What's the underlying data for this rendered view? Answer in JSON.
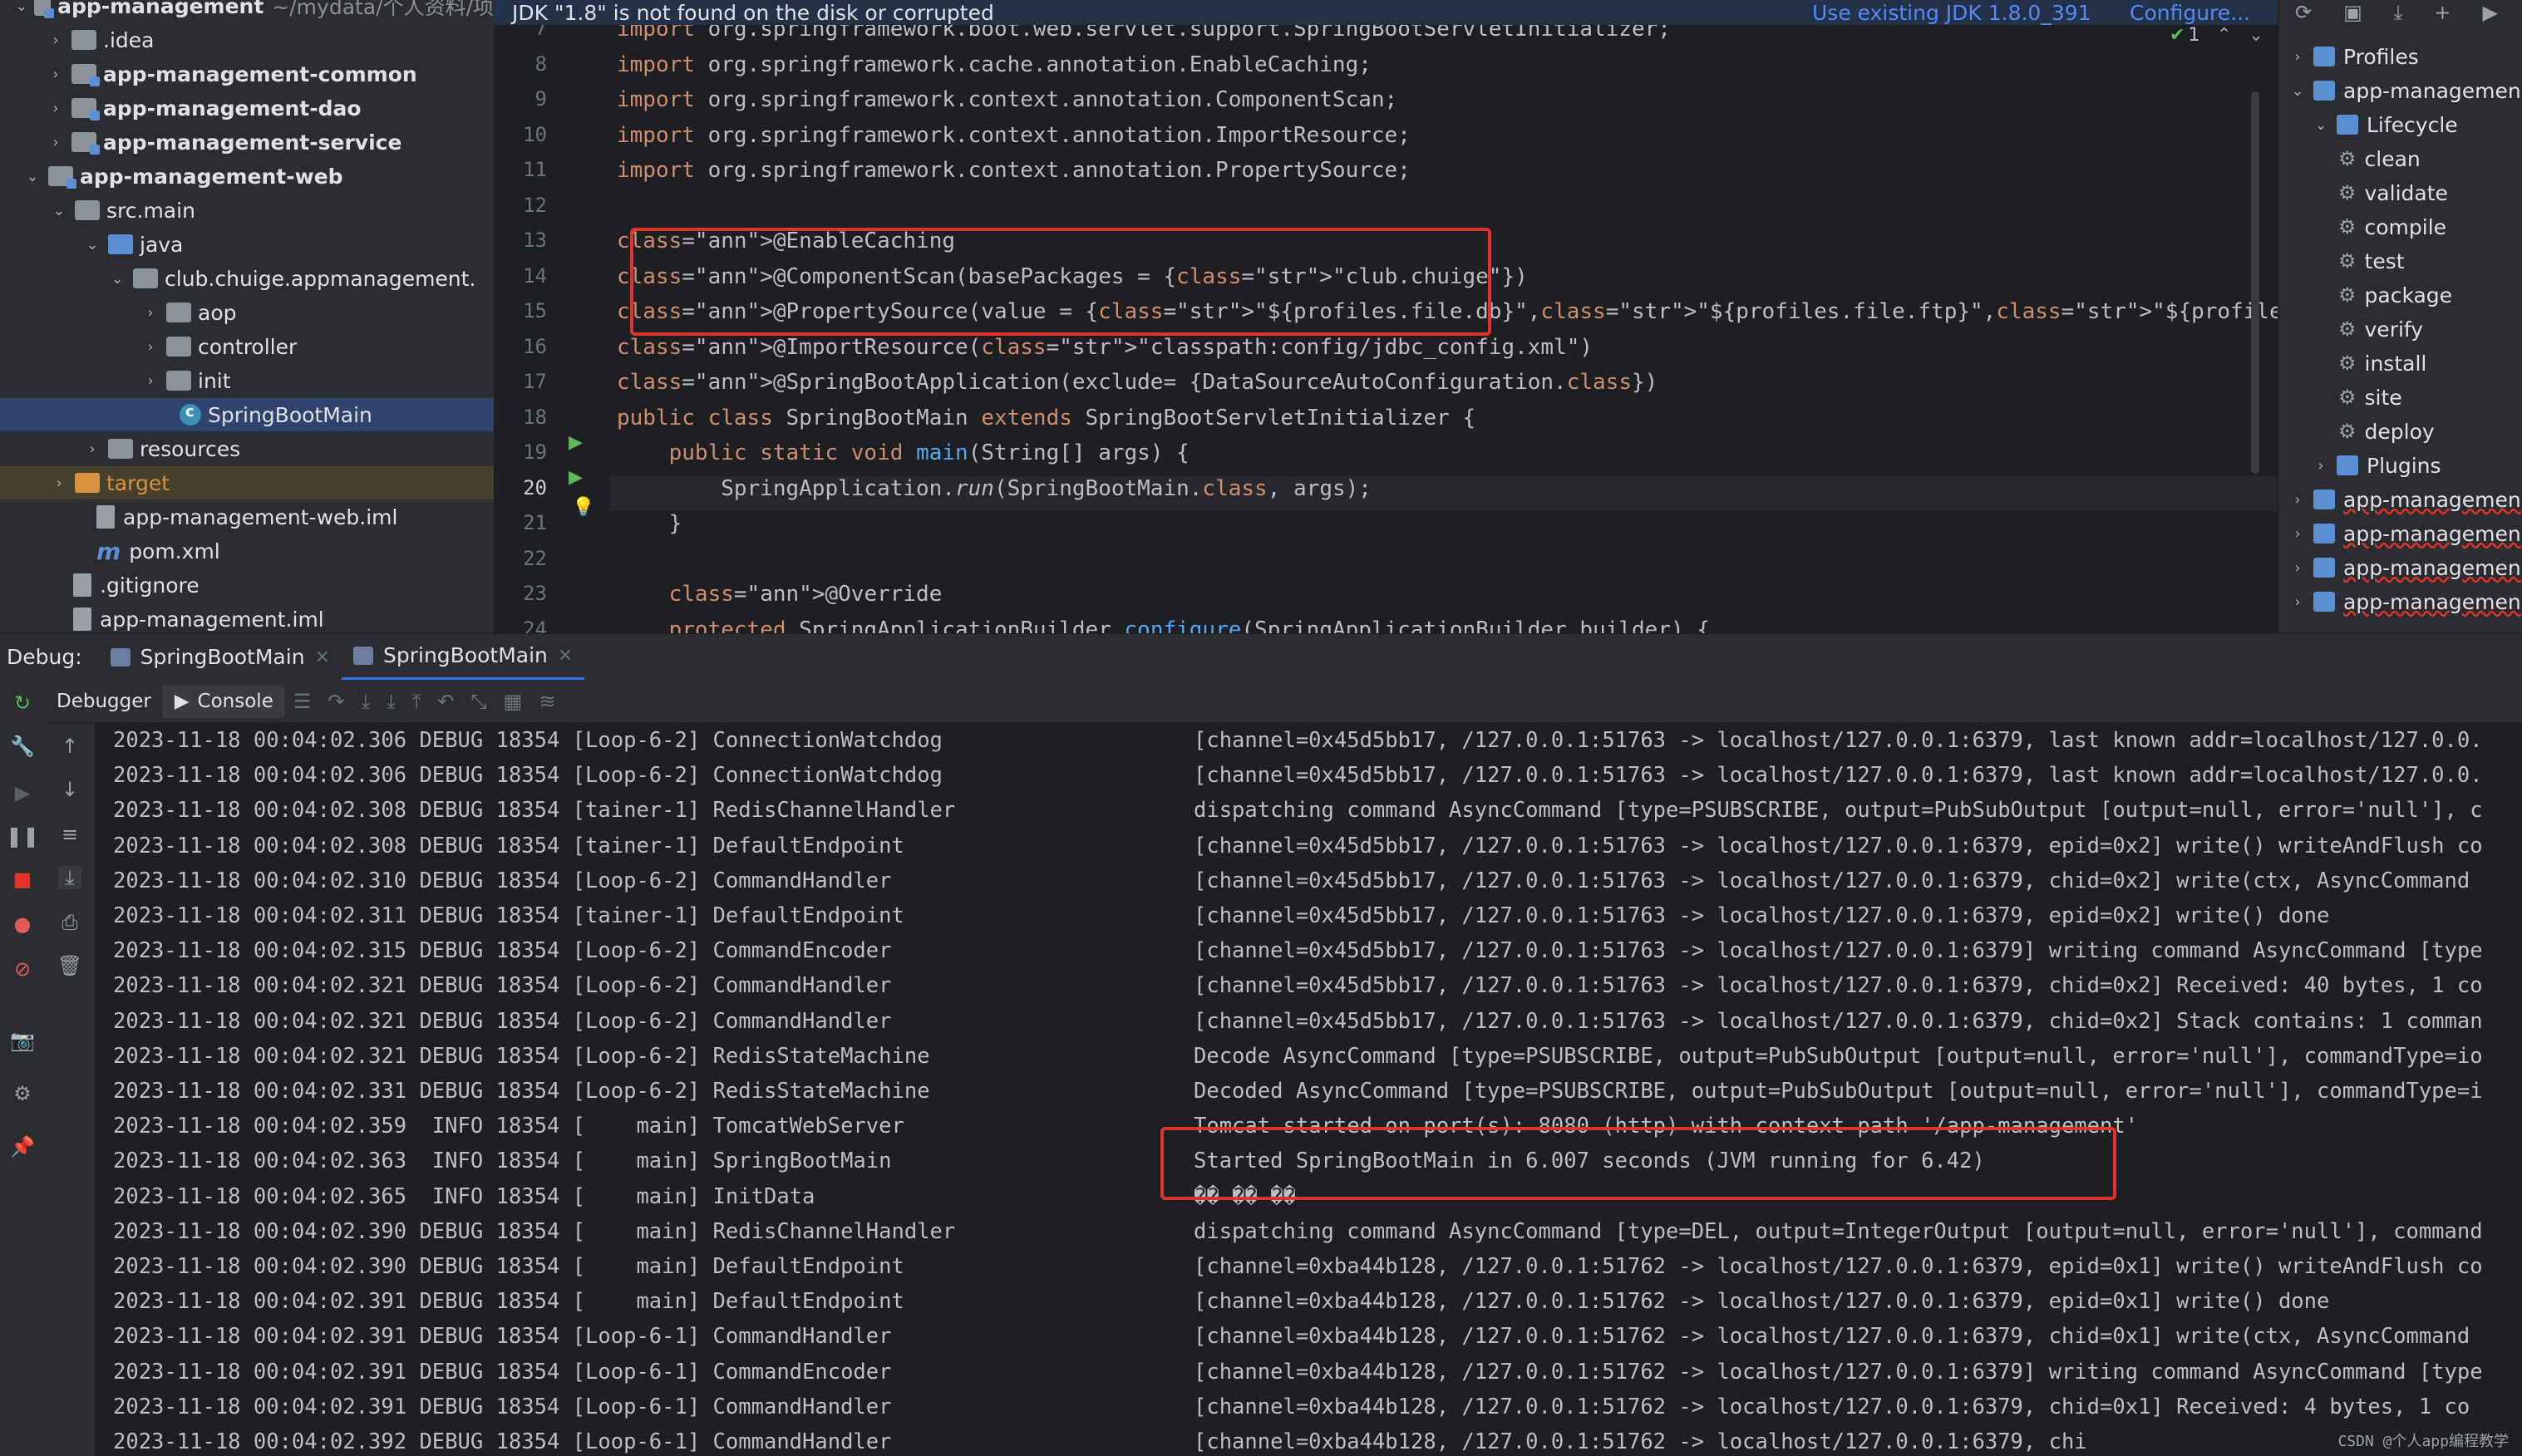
{
  "project_tree": {
    "items": [
      {
        "label": "app-management",
        "suffix": "~/mydata/个人资料/项",
        "kind": "module",
        "bold": true,
        "chevron": "down"
      },
      {
        "label": ".idea",
        "kind": "folder",
        "chevron": "right"
      },
      {
        "label": "app-management-common",
        "kind": "module",
        "bold": true,
        "chevron": "right"
      },
      {
        "label": "app-management-dao",
        "kind": "module",
        "bold": true,
        "chevron": "right"
      },
      {
        "label": "app-management-service",
        "kind": "module",
        "bold": true,
        "chevron": "right"
      },
      {
        "label": "app-management-web",
        "kind": "module",
        "bold": true,
        "chevron": "down"
      },
      {
        "label": "src.main",
        "kind": "folder",
        "chevron": "down"
      },
      {
        "label": "java",
        "kind": "folder-blue",
        "chevron": "down"
      },
      {
        "label": "club.chuige.appmanagement.",
        "kind": "package",
        "chevron": "down"
      },
      {
        "label": "aop",
        "kind": "package",
        "chevron": "right"
      },
      {
        "label": "controller",
        "kind": "package",
        "chevron": "right"
      },
      {
        "label": "init",
        "kind": "package",
        "chevron": "right"
      },
      {
        "label": "SpringBootMain",
        "kind": "class",
        "selected": true
      },
      {
        "label": "resources",
        "kind": "folder",
        "chevron": "right"
      },
      {
        "label": "target",
        "kind": "folder-orange",
        "chevron": "right"
      },
      {
        "label": "app-management-web.iml",
        "kind": "file"
      },
      {
        "label": "pom.xml",
        "kind": "maven-file"
      },
      {
        "label": ".gitignore",
        "kind": "file"
      },
      {
        "label": "app-management.iml",
        "kind": "file"
      }
    ]
  },
  "banner": {
    "message": "JDK \"1.8\" is not found on the disk or corrupted",
    "use_existing": "Use existing JDK 1.8.0_391",
    "configure": "Configure..."
  },
  "editor": {
    "inspection_count": "1",
    "lines": [
      {
        "num": "7",
        "text": "import org.springframework.boot.web.servlet.support.SpringBootServletInitializer;"
      },
      {
        "num": "8",
        "text": "import org.springframework.cache.annotation.EnableCaching;"
      },
      {
        "num": "9",
        "text": "import org.springframework.context.annotation.ComponentScan;"
      },
      {
        "num": "10",
        "text": "import org.springframework.context.annotation.ImportResource;"
      },
      {
        "num": "11",
        "text": "import org.springframework.context.annotation.PropertySource;"
      },
      {
        "num": "12",
        "text": ""
      },
      {
        "num": "13",
        "text": "@EnableCaching"
      },
      {
        "num": "14",
        "text": "@ComponentScan(basePackages = {\"club.chuige\"})"
      },
      {
        "num": "15",
        "text": "@PropertySource(value = {\"${profiles.file.db}\",\"${profiles.file.ftp}\",\"${profiles.file.redis}\",\"classpath:properties/common.p"
      },
      {
        "num": "16",
        "text": "@ImportResource(\"classpath:config/jdbc_config.xml\")"
      },
      {
        "num": "17",
        "text": "@SpringBootApplication(exclude= {DataSourceAutoConfiguration.class})"
      },
      {
        "num": "18",
        "text": "public class SpringBootMain extends SpringBootServletInitializer {"
      },
      {
        "num": "19",
        "text": "    public static void main(String[] args) {"
      },
      {
        "num": "20",
        "text": "        SpringApplication.run(SpringBootMain.class, args);"
      },
      {
        "num": "21",
        "text": "    }"
      },
      {
        "num": "22",
        "text": ""
      },
      {
        "num": "23",
        "text": "    @Override"
      },
      {
        "num": "24",
        "text": "    protected SpringApplicationBuilder configure(SpringApplicationBuilder builder) {"
      }
    ]
  },
  "maven": {
    "items": [
      {
        "label": "Profiles",
        "level": 0,
        "chevron": "right"
      },
      {
        "label": "app-managemen",
        "level": 0,
        "chevron": "down"
      },
      {
        "label": "Lifecycle",
        "level": 1,
        "chevron": "down"
      },
      {
        "label": "clean",
        "level": 2
      },
      {
        "label": "validate",
        "level": 2
      },
      {
        "label": "compile",
        "level": 2
      },
      {
        "label": "test",
        "level": 2
      },
      {
        "label": "package",
        "level": 2
      },
      {
        "label": "verify",
        "level": 2
      },
      {
        "label": "install",
        "level": 2
      },
      {
        "label": "site",
        "level": 2
      },
      {
        "label": "deploy",
        "level": 2
      },
      {
        "label": "Plugins",
        "level": 1,
        "chevron": "right"
      },
      {
        "label": "app-managemen",
        "level": 0,
        "chevron": "right",
        "error": true
      },
      {
        "label": "app-managemen",
        "level": 0,
        "chevron": "right",
        "error": true
      },
      {
        "label": "app-managemen",
        "level": 0,
        "chevron": "right",
        "error": true
      },
      {
        "label": "app-managemen",
        "level": 0,
        "chevron": "right",
        "error": true
      }
    ]
  },
  "debug": {
    "label": "Debug:",
    "tabs": [
      {
        "label": "SpringBootMain"
      },
      {
        "label": "SpringBootMain",
        "active": true
      }
    ],
    "toolbar": {
      "debugger": "Debugger",
      "console": "Console"
    }
  },
  "console": {
    "lines": [
      {
        "prefix": "2023-11-18 00:04:02.306 DEBUG 18354 [Loop-6-2] ConnectionWatchdog",
        "msg": "[channel=0x45d5bb17, /127.0.0.1:51763 -> localhost/127.0.0.1:6379, last known addr=localhost/127.0.0."
      },
      {
        "prefix": "2023-11-18 00:04:02.306 DEBUG 18354 [Loop-6-2] ConnectionWatchdog",
        "msg": "[channel=0x45d5bb17, /127.0.0.1:51763 -> localhost/127.0.0.1:6379, last known addr=localhost/127.0.0."
      },
      {
        "prefix": "2023-11-18 00:04:02.308 DEBUG 18354 [tainer-1] RedisChannelHandler",
        "msg": "dispatching command AsyncCommand [type=PSUBSCRIBE, output=PubSubOutput [output=null, error='null'], c"
      },
      {
        "prefix": "2023-11-18 00:04:02.308 DEBUG 18354 [tainer-1] DefaultEndpoint",
        "msg": "[channel=0x45d5bb17, /127.0.0.1:51763 -> localhost/127.0.0.1:6379, epid=0x2] write() writeAndFlush co"
      },
      {
        "prefix": "2023-11-18 00:04:02.310 DEBUG 18354 [Loop-6-2] CommandHandler",
        "msg": "[channel=0x45d5bb17, /127.0.0.1:51763 -> localhost/127.0.0.1:6379, chid=0x2] write(ctx, AsyncCommand"
      },
      {
        "prefix": "2023-11-18 00:04:02.311 DEBUG 18354 [tainer-1] DefaultEndpoint",
        "msg": "[channel=0x45d5bb17, /127.0.0.1:51763 -> localhost/127.0.0.1:6379, epid=0x2] write() done"
      },
      {
        "prefix": "2023-11-18 00:04:02.315 DEBUG 18354 [Loop-6-2] CommandEncoder",
        "msg": "[channel=0x45d5bb17, /127.0.0.1:51763 -> localhost/127.0.0.1:6379] writing command AsyncCommand [type"
      },
      {
        "prefix": "2023-11-18 00:04:02.321 DEBUG 18354 [Loop-6-2] CommandHandler",
        "msg": "[channel=0x45d5bb17, /127.0.0.1:51763 -> localhost/127.0.0.1:6379, chid=0x2] Received: 40 bytes, 1 co"
      },
      {
        "prefix": "2023-11-18 00:04:02.321 DEBUG 18354 [Loop-6-2] CommandHandler",
        "msg": "[channel=0x45d5bb17, /127.0.0.1:51763 -> localhost/127.0.0.1:6379, chid=0x2] Stack contains: 1 comman"
      },
      {
        "prefix": "2023-11-18 00:04:02.321 DEBUG 18354 [Loop-6-2] RedisStateMachine",
        "msg": "Decode AsyncCommand [type=PSUBSCRIBE, output=PubSubOutput [output=null, error='null'], commandType=io"
      },
      {
        "prefix": "2023-11-18 00:04:02.331 DEBUG 18354 [Loop-6-2] RedisStateMachine",
        "msg": "Decoded AsyncCommand [type=PSUBSCRIBE, output=PubSubOutput [output=null, error='null'], commandType=i"
      },
      {
        "prefix": "2023-11-18 00:04:02.359  INFO 18354 [    main] TomcatWebServer",
        "msg": "Tomcat started on port(s): 8080 (http) with context path '/app-management'"
      },
      {
        "prefix": "2023-11-18 00:04:02.363  INFO 18354 [    main] SpringBootMain",
        "msg": "Started SpringBootMain in 6.007 seconds (JVM running for 6.42)",
        "highlight": true
      },
      {
        "prefix": "2023-11-18 00:04:02.365  INFO 18354 [    main] InitData",
        "msg": "�� �� ��"
      },
      {
        "prefix": "2023-11-18 00:04:02.390 DEBUG 18354 [    main] RedisChannelHandler",
        "msg": "dispatching command AsyncCommand [type=DEL, output=IntegerOutput [output=null, error='null'], command"
      },
      {
        "prefix": "2023-11-18 00:04:02.390 DEBUG 18354 [    main] DefaultEndpoint",
        "msg": "[channel=0xba44b128, /127.0.0.1:51762 -> localhost/127.0.0.1:6379, epid=0x1] write() writeAndFlush co"
      },
      {
        "prefix": "2023-11-18 00:04:02.391 DEBUG 18354 [    main] DefaultEndpoint",
        "msg": "[channel=0xba44b128, /127.0.0.1:51762 -> localhost/127.0.0.1:6379, epid=0x1] write() done"
      },
      {
        "prefix": "2023-11-18 00:04:02.391 DEBUG 18354 [Loop-6-1] CommandHandler",
        "msg": "[channel=0xba44b128, /127.0.0.1:51762 -> localhost/127.0.0.1:6379, chid=0x1] write(ctx, AsyncCommand"
      },
      {
        "prefix": "2023-11-18 00:04:02.391 DEBUG 18354 [Loop-6-1] CommandEncoder",
        "msg": "[channel=0xba44b128, /127.0.0.1:51762 -> localhost/127.0.0.1:6379] writing command AsyncCommand [type"
      },
      {
        "prefix": "2023-11-18 00:04:02.391 DEBUG 18354 [Loop-6-1] CommandHandler",
        "msg": "[channel=0xba44b128, /127.0.0.1:51762 -> localhost/127.0.0.1:6379, chid=0x1] Received: 4 bytes, 1 co"
      },
      {
        "prefix": "2023-11-18 00:04:02.392 DEBUG 18354 [Loop-6-1] CommandHandler",
        "msg": "[channel=0xba44b128, /127.0.0.1:51762 -> localhost/127.0.0.1:6379, chi"
      }
    ]
  },
  "watermark": "CSDN @个人app编程教学",
  "colors": {
    "accent": "#3574f0",
    "highlight_box": "#e0342b",
    "keyword": "#cf8e6d",
    "annotation": "#b3ae60",
    "string": "#6aab73",
    "method": "#56a8f5"
  }
}
